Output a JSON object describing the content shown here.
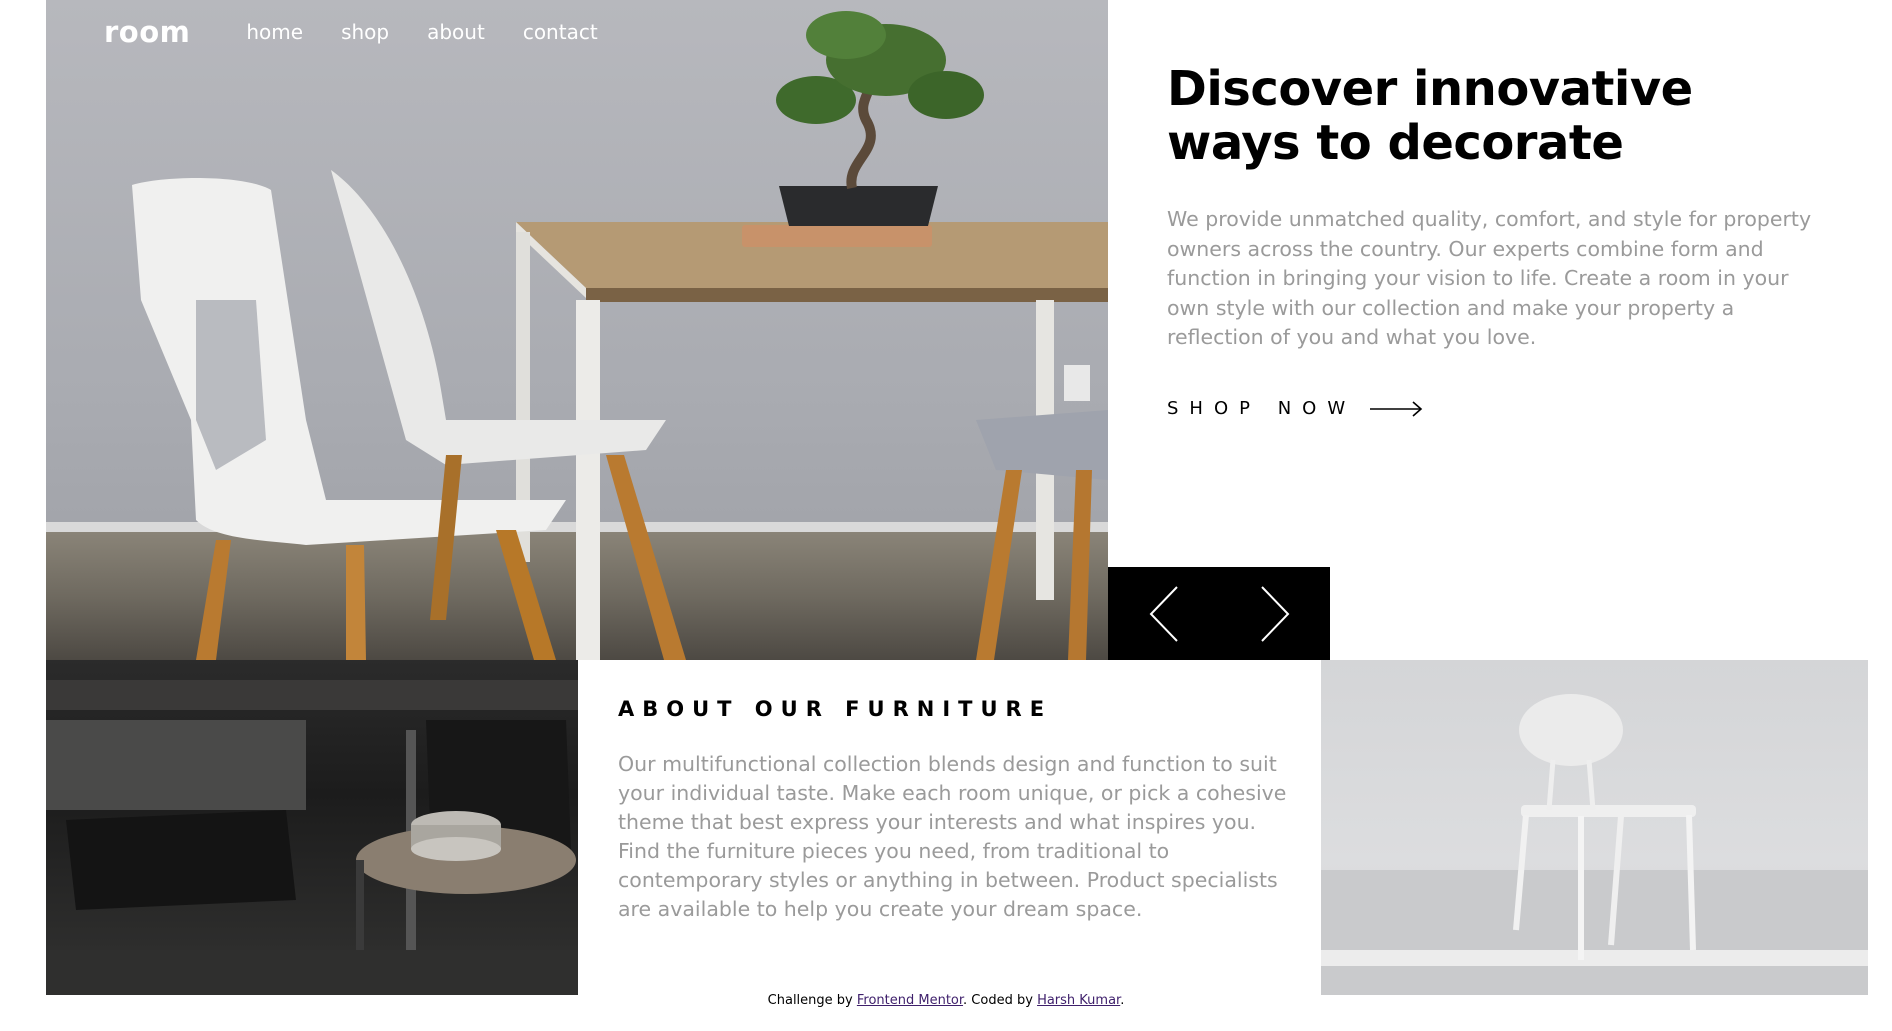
{
  "nav": {
    "logo": "room",
    "links": [
      "home",
      "shop",
      "about",
      "contact"
    ]
  },
  "hero": {
    "title_line1": "Discover innovative",
    "title_line2": "ways to decorate",
    "description": "We provide unmatched quality, comfort, and style for property owners across the country. Our experts combine form and function in bringing your vision to life. Create a room in your own style with our collection and make your property a reflection of you and what you love.",
    "cta_label": "SHOP NOW"
  },
  "slider": {
    "prev_icon": "chevron-left-icon",
    "next_icon": "chevron-right-icon"
  },
  "about": {
    "title": "ABOUT OUR FURNITURE",
    "text": "Our multifunctional collection blends design and function to suit your individual taste. Make each room unique, or pick a cohesive theme that best express your interests and what inspires you. Find the furniture pieces you need, from traditional to contemporary styles or anything in between. Product specialists are available to help you create your dream space."
  },
  "footer": {
    "prefix": "Challenge by",
    "frontend_mentor": "Frontend Mentor",
    "middle": ". Coded by",
    "author": "Harsh Kumar",
    "suffix": "."
  },
  "colors": {
    "text_dark": "#000000",
    "text_muted": "#9a9a9a",
    "link": "#3e1f6b",
    "slider_bg": "#000000"
  }
}
